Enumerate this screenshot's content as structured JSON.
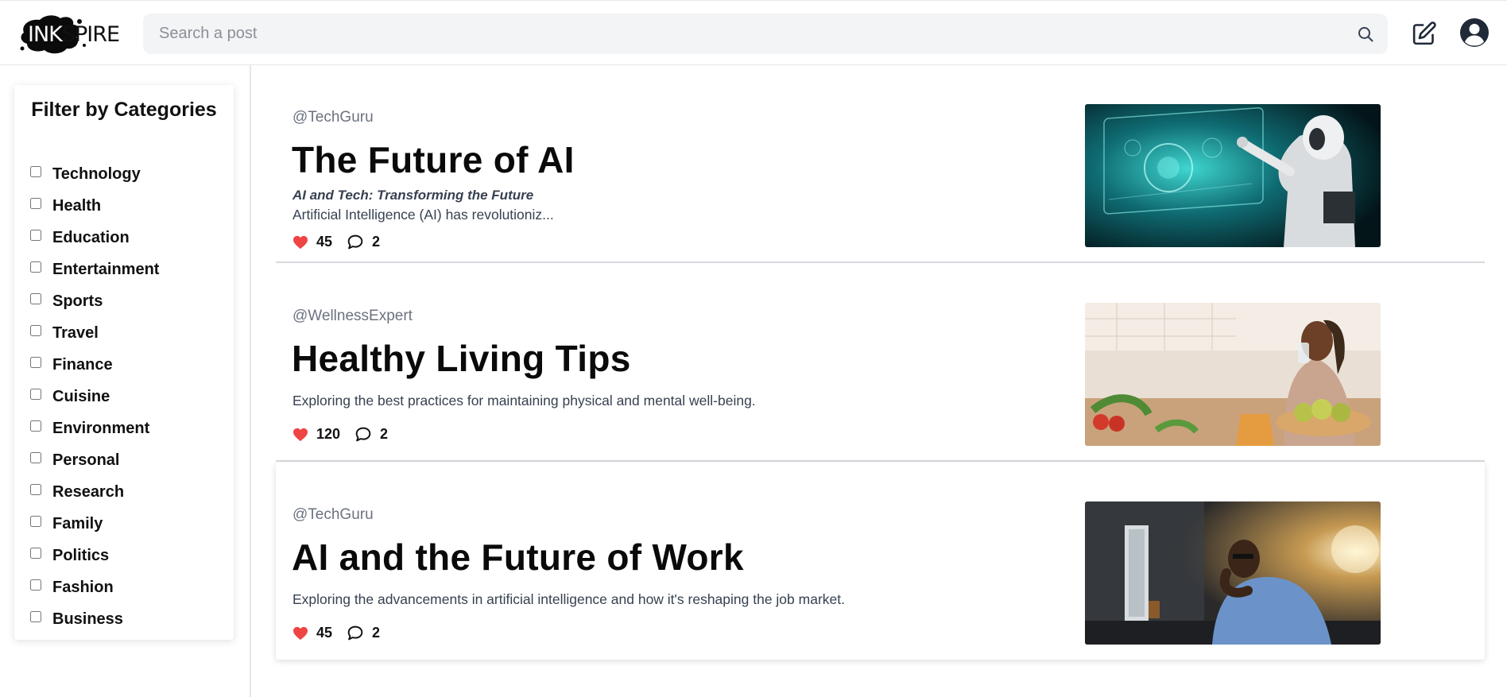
{
  "header": {
    "logo_text_ink": "INK",
    "logo_text_rest": "SPIRE",
    "search_placeholder": "Search a post"
  },
  "sidebar": {
    "title": "Filter by Categories",
    "categories": [
      "Technology",
      "Health",
      "Education",
      "Entertainment",
      "Sports",
      "Travel",
      "Finance",
      "Cuisine",
      "Environment",
      "Personal",
      "Research",
      "Family",
      "Politics",
      "Fashion",
      "Business"
    ]
  },
  "posts": [
    {
      "author": "@TechGuru",
      "title": "The Future of AI",
      "subtitle": "AI and Tech: Transforming the Future",
      "excerpt": "Artificial Intelligence (AI) has revolutioniz...",
      "likes": "45",
      "comments": "2",
      "image": "robot-touching-holographic-interface"
    },
    {
      "author": "@WellnessExpert",
      "title": "Healthy Living Tips",
      "excerpt": "Exploring the best practices for maintaining physical and mental well-being.",
      "likes": "120",
      "comments": "2",
      "image": "woman-drinking-water-at-kitchen-table"
    },
    {
      "author": "@TechGuru",
      "title": "AI and the Future of Work",
      "excerpt": "Exploring the advancements in artificial intelligence and how it's reshaping the job market.",
      "likes": "45",
      "comments": "2",
      "image": "stressed-man-at-computer-desk"
    }
  ],
  "colors": {
    "heart": "#ef4444",
    "search_bg": "#f3f4f6",
    "muted_text": "#6b7280"
  },
  "icons": [
    "search-icon",
    "edit-icon",
    "user-icon",
    "heart-icon",
    "comment-icon"
  ]
}
